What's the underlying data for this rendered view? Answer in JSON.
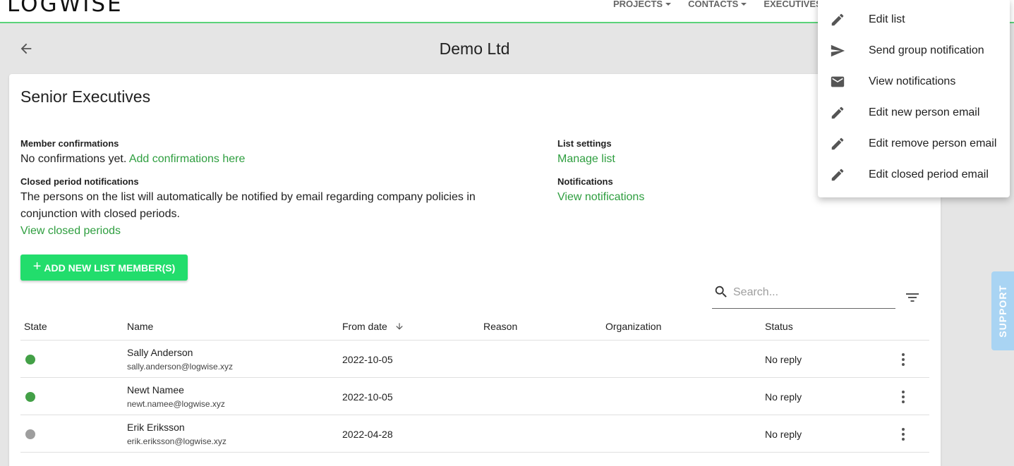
{
  "app": {
    "logo": "LOGWISE"
  },
  "nav": {
    "items": [
      {
        "label": "PROJECTS"
      },
      {
        "label": "CONTACTS"
      },
      {
        "label": "EXECUTIVES"
      }
    ]
  },
  "header": {
    "title": "Demo Ltd",
    "back_icon": "arrow-left-icon"
  },
  "card": {
    "title": "Senior Executives",
    "member_confirmations": {
      "label": "Member confirmations",
      "text": "No confirmations yet.",
      "link": "Add confirmations here"
    },
    "closed_period": {
      "label": "Closed period notifications",
      "text_line1": "The persons on the list will automatically be notified by email regarding company policies in",
      "text_line2": "conjunction with closed periods.",
      "link": "View closed periods"
    },
    "list_settings": {
      "label": "List settings",
      "link": "Manage list"
    },
    "notifications": {
      "label": "Notifications",
      "link": "View notifications"
    },
    "add_button": "ADD NEW LIST MEMBER(S)",
    "search": {
      "placeholder": "Search...",
      "value": ""
    }
  },
  "table": {
    "columns": [
      "State",
      "Name",
      "From date",
      "Reason",
      "Organization",
      "Status"
    ],
    "rows": [
      {
        "state_color": "#43a047",
        "name": "Sally Anderson",
        "email": "sally.anderson@logwise.xyz",
        "from_date": "2022-10-05",
        "reason": "",
        "organization": "",
        "status": "No reply"
      },
      {
        "state_color": "#43a047",
        "name": "Newt Namee",
        "email": "newt.namee@logwise.xyz",
        "from_date": "2022-10-05",
        "reason": "",
        "organization": "",
        "status": "No reply"
      },
      {
        "state_color": "#9e9e9e",
        "name": "Erik Eriksson",
        "email": "erik.eriksson@logwise.xyz",
        "from_date": "2022-04-28",
        "reason": "",
        "organization": "",
        "status": "No reply"
      }
    ]
  },
  "menu": {
    "items": [
      {
        "icon": "pencil-icon",
        "label": "Edit list"
      },
      {
        "icon": "send-icon",
        "label": "Send group notification"
      },
      {
        "icon": "mail-icon",
        "label": "View notifications"
      },
      {
        "icon": "pencil-icon",
        "label": "Edit new person email"
      },
      {
        "icon": "pencil-icon",
        "label": "Edit remove person email"
      },
      {
        "icon": "pencil-icon",
        "label": "Edit closed period email"
      }
    ]
  },
  "support": {
    "label": "SUPPORT"
  },
  "colors": {
    "accent": "#22dd6c",
    "link": "#2e9e3f",
    "nav_border": "#5bd37a",
    "support_bg": "#a9d4f3"
  }
}
